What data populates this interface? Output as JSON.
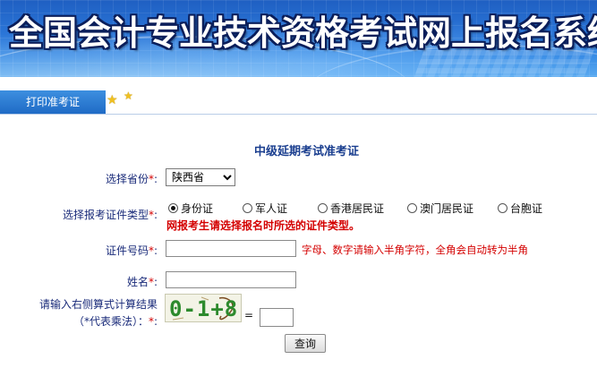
{
  "banner": {
    "title": "全国会计专业技术资格考试网上报名系统"
  },
  "tabs": [
    {
      "label": "打印准考证"
    }
  ],
  "form": {
    "heading": "中级延期考试准考证",
    "required_mark": "*",
    "province": {
      "label": "选择省份",
      "suffix": ":",
      "selected": "陕西省",
      "options": [
        "陕西省"
      ]
    },
    "id_type": {
      "label": "选择报考证件类型",
      "suffix": ":",
      "options": [
        {
          "label": "身份证",
          "checked": true
        },
        {
          "label": "军人证",
          "checked": false
        },
        {
          "label": "香港居民证",
          "checked": false
        },
        {
          "label": "澳门居民证",
          "checked": false
        },
        {
          "label": "台胞证",
          "checked": false
        }
      ],
      "notice": "网报考生请选择报名时所选的证件类型。"
    },
    "id_number": {
      "label": "证件号码",
      "suffix": ":",
      "value": "",
      "hint": "字母、数字请输入半角字符，全角会自动转为半角"
    },
    "name": {
      "label": "姓名",
      "suffix": ":",
      "value": ""
    },
    "captcha": {
      "label_line1": "请输入右侧算式计算结果",
      "label_line2": "（*代表乘法）：",
      "suffix": ":",
      "image_text": "0-1+8",
      "equals": "=",
      "value": ""
    },
    "submit_label": "查询"
  }
}
